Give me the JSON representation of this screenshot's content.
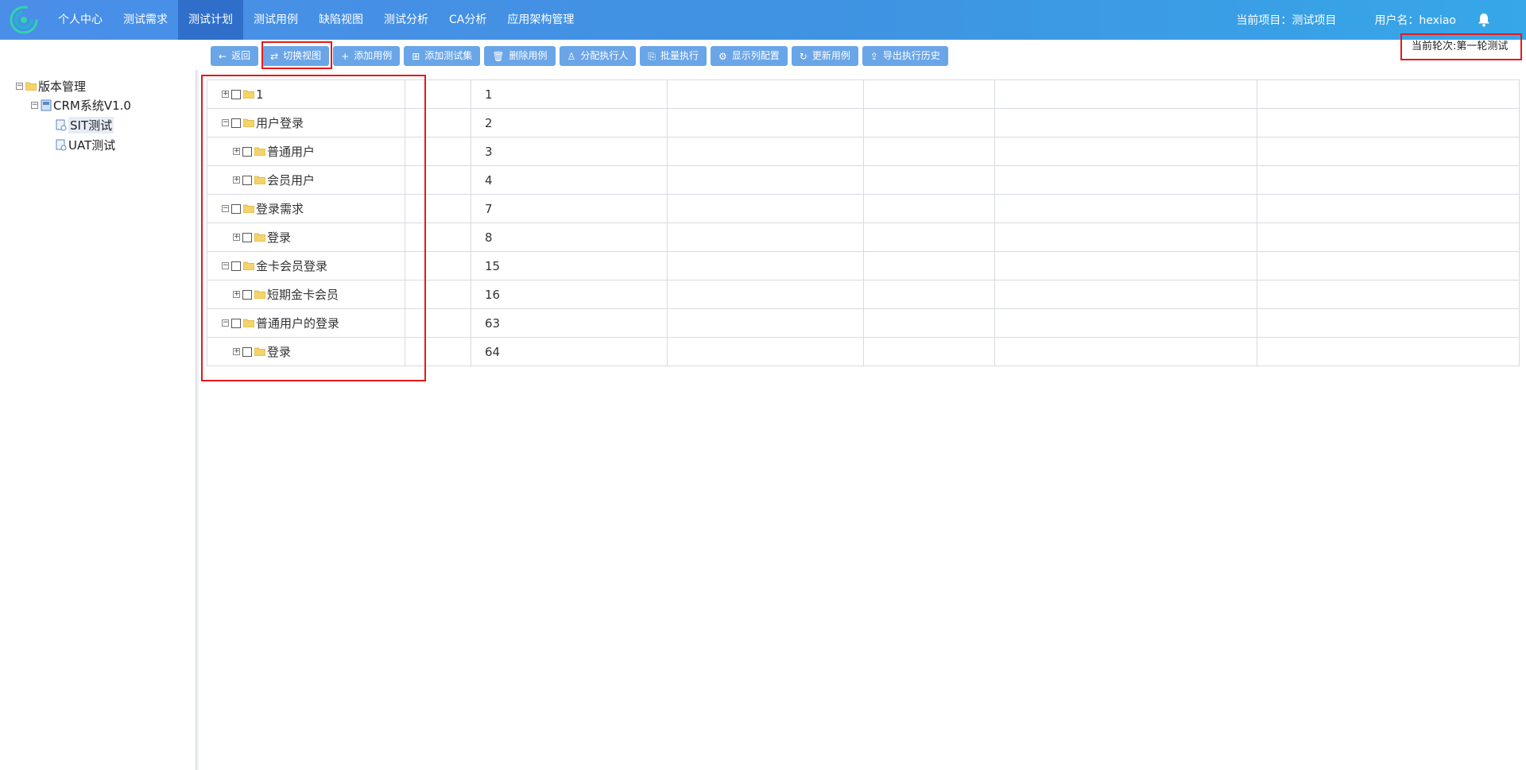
{
  "nav": {
    "items": [
      "个人中心",
      "测试需求",
      "测试计划",
      "测试用例",
      "缺陷视图",
      "测试分析",
      "CA分析",
      "应用架构管理"
    ],
    "active_index": 2,
    "project": "当前项目：测试项目",
    "user": "用户名：hexiao"
  },
  "toolbar": {
    "buttons": [
      {
        "label": "返回",
        "icon": "arrow-left-icon",
        "glyph": "←"
      },
      {
        "label": "切换视图",
        "icon": "swap-icon",
        "glyph": "⇄"
      },
      {
        "label": "添加用例",
        "icon": "plus-icon",
        "glyph": "+"
      },
      {
        "label": "添加测试集",
        "icon": "plus-square-icon",
        "glyph": "⊞"
      },
      {
        "label": "删除用例",
        "icon": "trash-icon",
        "glyph": "🗑"
      },
      {
        "label": "分配执行人",
        "icon": "user-icon",
        "glyph": "♙"
      },
      {
        "label": "批量执行",
        "icon": "batch-icon",
        "glyph": "⎘"
      },
      {
        "label": "显示列配置",
        "icon": "gear-icon",
        "glyph": "⚙"
      },
      {
        "label": "更新用例",
        "icon": "refresh-icon",
        "glyph": "↻"
      },
      {
        "label": "导出执行历史",
        "icon": "export-icon",
        "glyph": "⇪"
      }
    ]
  },
  "round": "当前轮次:第一轮测试",
  "tree": {
    "root": "版本管理",
    "system": "CRM系统V1.0",
    "children": [
      "SIT测试",
      "UAT测试"
    ],
    "selected": "SIT测试"
  },
  "grid": {
    "rows": [
      {
        "name": "1",
        "id": "1",
        "expanded": false,
        "level": 0
      },
      {
        "name": "用户登录",
        "id": "2",
        "expanded": true,
        "level": 0
      },
      {
        "name": "普通用户",
        "id": "3",
        "expanded": false,
        "level": 1
      },
      {
        "name": "会员用户",
        "id": "4",
        "expanded": false,
        "level": 1
      },
      {
        "name": "登录需求",
        "id": "7",
        "expanded": true,
        "level": 0
      },
      {
        "name": "登录",
        "id": "8",
        "expanded": false,
        "level": 1
      },
      {
        "name": "金卡会员登录",
        "id": "15",
        "expanded": true,
        "level": 0
      },
      {
        "name": "短期金卡会员",
        "id": "16",
        "expanded": false,
        "level": 1
      },
      {
        "name": "普通用户的登录",
        "id": "63",
        "expanded": true,
        "level": 0
      },
      {
        "name": "登录",
        "id": "64",
        "expanded": false,
        "level": 1
      }
    ]
  },
  "colors": {
    "nav_start": "#4a8ee8",
    "nav_active": "#2f6fc9",
    "button": "#6aa5e8",
    "highlight": "#e5191b"
  }
}
